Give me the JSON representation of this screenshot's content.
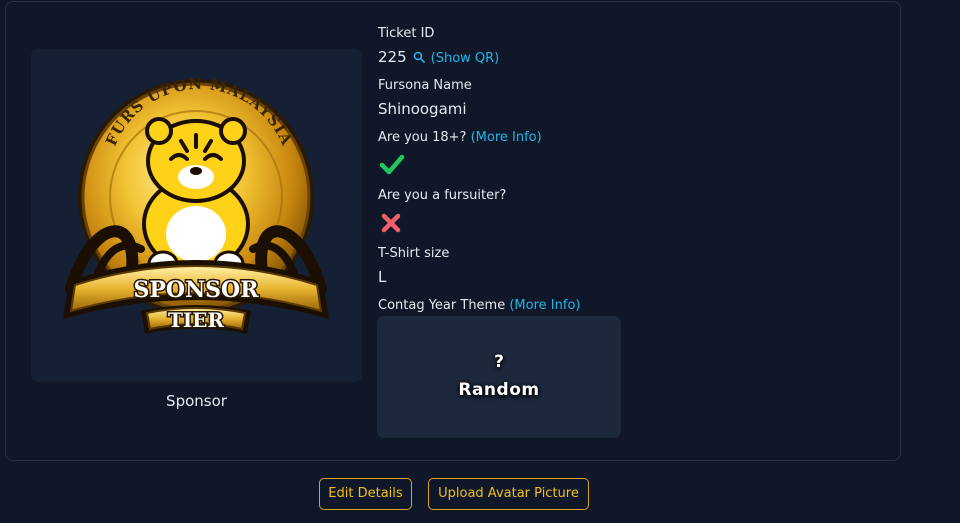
{
  "badge": {
    "arc_text": "FURS UPON MALAYSIA",
    "banner_line1": "SPONSOR",
    "banner_line2": "TIER",
    "tier_label": "Sponsor"
  },
  "fields": {
    "ticket_id_label": "Ticket ID",
    "ticket_id_value": "225",
    "show_qr_link": "(Show QR)",
    "fursona_label": "Fursona Name",
    "fursona_value": "Shinoogami",
    "adult_label": "Are you 18+?",
    "adult_more_info": "(More Info)",
    "adult_status": "check-icon",
    "fursuiter_label": "Are you a fursuiter?",
    "fursuiter_status": "cross-icon",
    "shirt_label": "T-Shirt size",
    "shirt_value": "L",
    "theme_label": "Contag Year Theme",
    "theme_more_info": "(More Info)"
  },
  "theme_card": {
    "symbol": "?",
    "name": "Random"
  },
  "actions": {
    "edit_details": "Edit Details",
    "upload_avatar": "Upload Avatar Picture"
  },
  "colors": {
    "background": "#0f1729",
    "panel": "#162034",
    "link": "#21b6e6",
    "accent": "#f2c019",
    "check": "#22c55e",
    "cross": "#f0606a"
  }
}
